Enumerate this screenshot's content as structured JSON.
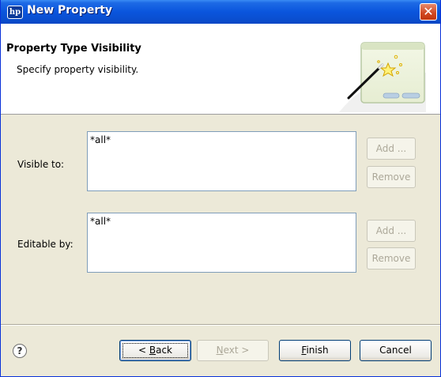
{
  "window": {
    "title": "New Property",
    "app_icon_text": "hp",
    "close_glyph": "✕"
  },
  "banner": {
    "title": "Property Type Visibility",
    "description": "Specify property visibility."
  },
  "visible_to": {
    "label": "Visible to:",
    "items": [
      "*all*"
    ],
    "add_label": "Add ...",
    "remove_label": "Remove"
  },
  "editable_by": {
    "label": "Editable by:",
    "items": [
      "*all*"
    ],
    "add_label": "Add ...",
    "remove_label": "Remove"
  },
  "footer": {
    "help_glyph": "?",
    "back_pre": "< ",
    "back_mnemonic": "B",
    "back_post": "ack",
    "next_mnemonic": "N",
    "next_post": "ext >",
    "finish_mnemonic": "F",
    "finish_post": "inish",
    "cancel_label": "Cancel"
  },
  "colors": {
    "titlebar": "#0a55dd",
    "dialog_bg": "#ece9d8",
    "close_button": "#d0461f",
    "disabled_text": "#aca899"
  },
  "icons": {
    "app": "hp-logo-icon",
    "close": "close-icon",
    "wizard": "magic-wand-wizard-icon",
    "help": "help-icon"
  }
}
